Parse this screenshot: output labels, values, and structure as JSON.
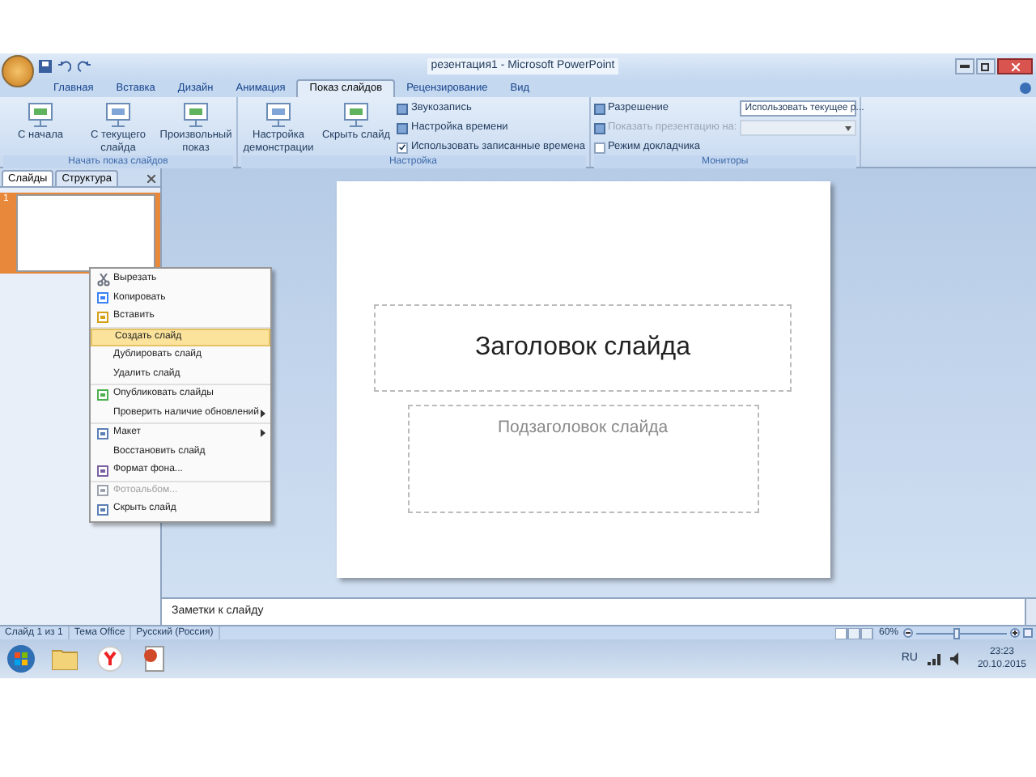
{
  "window": {
    "title": "резентация1 - Microsoft PowerPoint"
  },
  "ribbon": {
    "tabs": [
      {
        "label": "Главная",
        "selected": false
      },
      {
        "label": "Вставка",
        "selected": false
      },
      {
        "label": "Дизайн",
        "selected": false
      },
      {
        "label": "Анимация",
        "selected": false
      },
      {
        "label": "Показ слайдов",
        "selected": true
      },
      {
        "label": "Рецензирование",
        "selected": false
      },
      {
        "label": "Вид",
        "selected": false
      }
    ],
    "groups": [
      {
        "label": "Начать показ слайдов",
        "items": [
          {
            "kind": "large",
            "label": "С начала"
          },
          {
            "kind": "large",
            "label": "С текущего слайда"
          },
          {
            "kind": "large",
            "label": "Произвольный показ"
          }
        ]
      },
      {
        "label": "Настройка",
        "items": [
          {
            "kind": "large",
            "label": "Настройка демонстрации"
          },
          {
            "kind": "large",
            "label": "Скрыть слайд"
          },
          {
            "kind": "column",
            "rows": [
              {
                "kind": "small",
                "label": "Звукозапись",
                "disabled": false
              },
              {
                "kind": "small",
                "label": "Настройка времени",
                "disabled": false
              },
              {
                "kind": "check",
                "label": "Использовать записанные времена",
                "checked": true,
                "disabled": false
              }
            ]
          }
        ]
      },
      {
        "label": "Мониторы",
        "items": [
          {
            "kind": "column",
            "rows": [
              {
                "kind": "small",
                "label": "Разрешение",
                "disabled": false
              },
              {
                "kind": "small",
                "label": "Показать презентацию на:",
                "disabled": true
              },
              {
                "kind": "check",
                "label": "Режим докладчика",
                "checked": false,
                "disabled": false
              }
            ]
          },
          {
            "kind": "column",
            "rows": [
              {
                "kind": "select",
                "value": "Использовать текущее р...",
                "disabled": false
              },
              {
                "kind": "select",
                "disabled": true
              }
            ]
          }
        ]
      }
    ]
  },
  "panel": {
    "tabs": [
      {
        "label": "Слайды",
        "selected": true
      },
      {
        "label": "Структура",
        "selected": false
      }
    ],
    "slides": [
      {
        "number": "1",
        "selected": true
      }
    ]
  },
  "context_menu": {
    "groups": [
      [
        {
          "label": "Вырезать",
          "selected": false,
          "disabled": false,
          "submenu": false
        },
        {
          "label": "Копировать",
          "selected": false,
          "disabled": false,
          "submenu": false
        },
        {
          "label": "Вставить",
          "selected": false,
          "disabled": false,
          "submenu": false
        }
      ],
      [
        {
          "label": "Создать слайд",
          "selected": true,
          "disabled": false,
          "submenu": false
        },
        {
          "label": "Дублировать слайд",
          "selected": false,
          "disabled": false,
          "submenu": false
        },
        {
          "label": "Удалить слайд",
          "selected": false,
          "disabled": false,
          "submenu": false
        }
      ],
      [
        {
          "label": "Опубликовать слайды",
          "selected": false,
          "disabled": false,
          "submenu": false
        },
        {
          "label": "Проверить наличие обновлений",
          "selected": false,
          "disabled": false,
          "submenu": true
        }
      ],
      [
        {
          "label": "Макет",
          "selected": false,
          "disabled": false,
          "submenu": true
        },
        {
          "label": "Восстановить слайд",
          "selected": false,
          "disabled": false,
          "submenu": false
        },
        {
          "label": "Формат фона...",
          "selected": false,
          "disabled": false,
          "submenu": false
        }
      ],
      [
        {
          "label": "Фотоальбом...",
          "selected": false,
          "disabled": true,
          "submenu": false
        },
        {
          "label": "Скрыть слайд",
          "selected": false,
          "disabled": false,
          "submenu": false
        }
      ]
    ]
  },
  "slide": {
    "title": "Заголовок слайда",
    "subtitle": "Подзаголовок слайда"
  },
  "notes": {
    "placeholder": "Заметки к слайду"
  },
  "status_bar": {
    "items": [
      "Слайд 1 из 1",
      "Тема Office",
      "Русский (Россия)"
    ],
    "zoom": "60%",
    "zoom_slider": {
      "level": 0.45
    }
  },
  "taskbar": {
    "apps": [
      {
        "kind": "explorer"
      },
      {
        "kind": "browser"
      },
      {
        "kind": "powerpoint"
      }
    ],
    "language": "RU",
    "time": "23:23",
    "date": "20.10.2015"
  }
}
